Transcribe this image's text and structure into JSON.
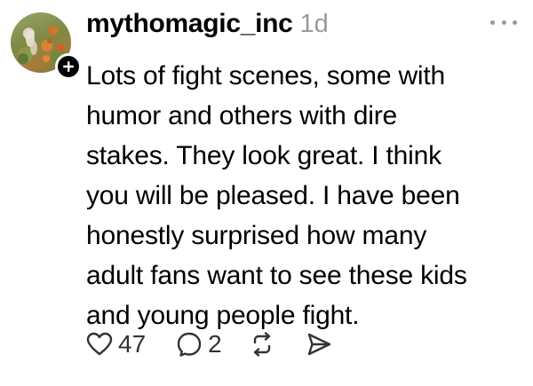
{
  "post": {
    "username": "mythomagic_inc",
    "timestamp": "1d",
    "body_lines": [
      "Lots of fight scenes, some with",
      "humor and others with dire",
      "stakes. They look great. I think",
      "you will be pleased. I have been",
      "honestly surprised how many",
      "adult fans want to see these kids",
      "and young people fight."
    ],
    "likes": "47",
    "replies": "2"
  },
  "icons": {
    "more": "more-horizontal-icon",
    "follow": "plus-icon",
    "like": "heart-icon",
    "reply": "comment-icon",
    "repost": "repost-icon",
    "share": "send-icon"
  },
  "colors": {
    "text": "#000000",
    "muted": "#9a9a9a",
    "icon": "#333333"
  }
}
